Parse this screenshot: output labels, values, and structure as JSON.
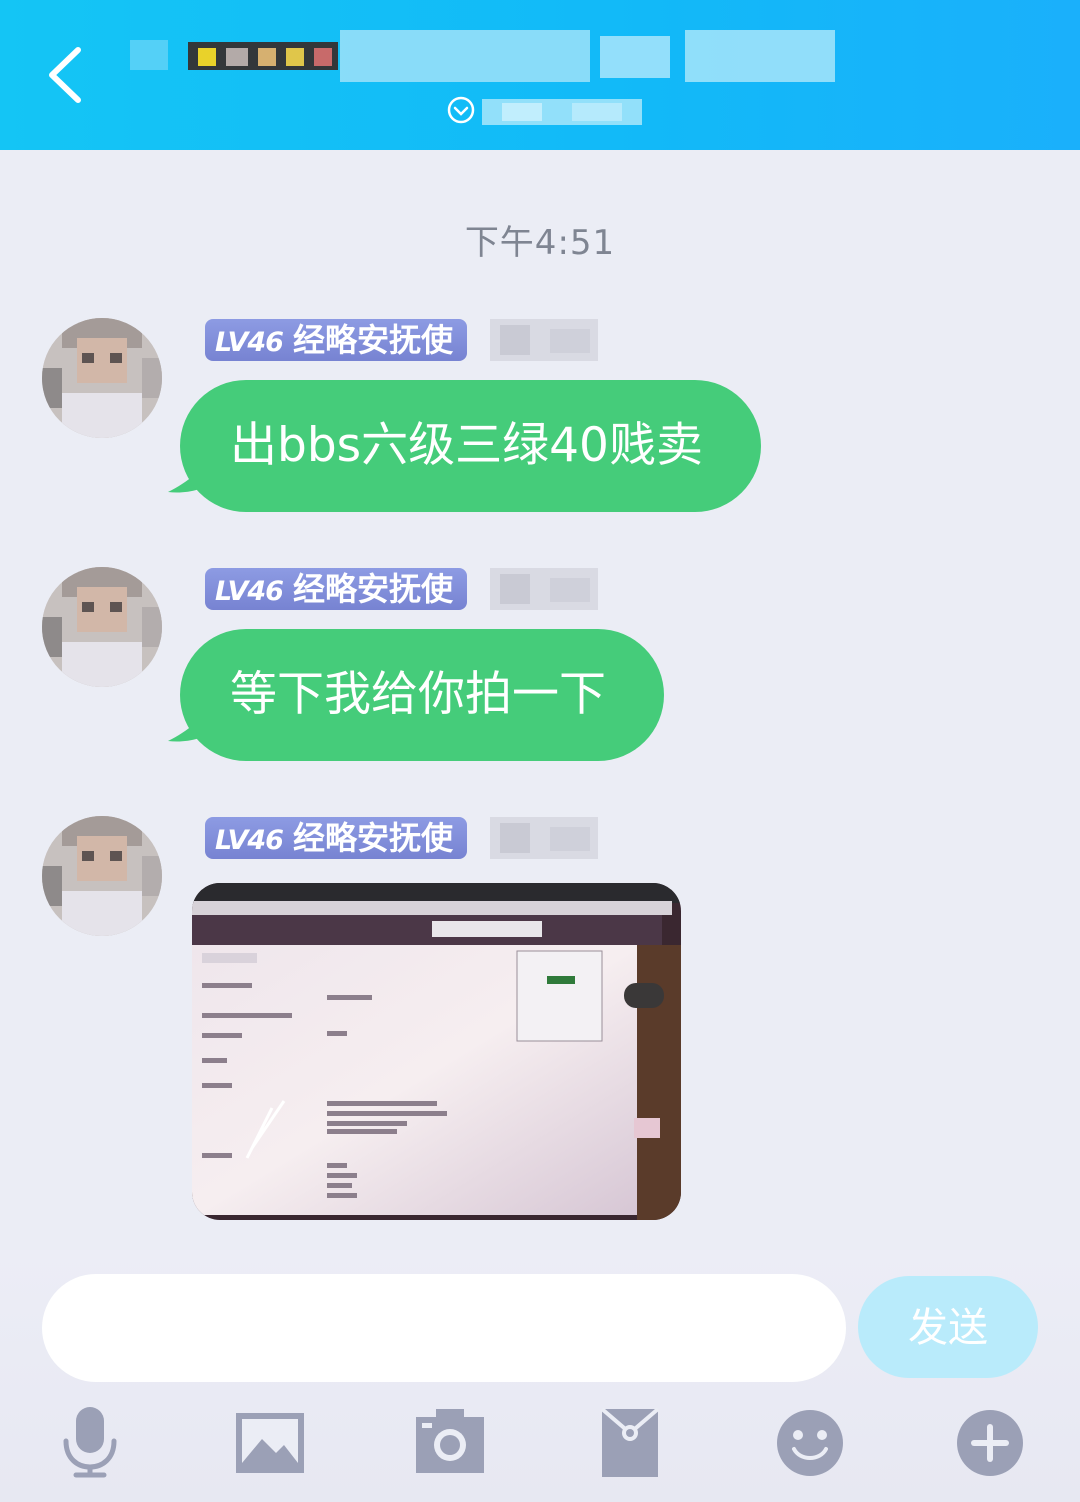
{
  "header": {
    "back_label": "back",
    "subtitle_expand_icon": "chevron-down-circle-icon",
    "title_redacted": true,
    "subtitle_redacted": true
  },
  "chat": {
    "timestamp": "下午4:51",
    "messages": [
      {
        "sender_level": "LV46",
        "sender_title": "经略安抚使",
        "type": "text",
        "text": "出bbs六级三绿40贱卖"
      },
      {
        "sender_level": "LV46",
        "sender_title": "经略安抚使",
        "type": "text",
        "text": "等下我给你拍一下"
      },
      {
        "sender_level": "LV46",
        "sender_title": "经略安抚使",
        "type": "image"
      }
    ]
  },
  "composer": {
    "input_value": "",
    "send_label": "发送",
    "tools": [
      "microphone-icon",
      "image-icon",
      "camera-icon",
      "red-packet-icon",
      "emoji-icon",
      "plus-icon"
    ]
  },
  "colors": {
    "header_blue": "#14c5f5",
    "bubble_green": "#45cc7a",
    "badge_purple": "#7f8ddb",
    "background": "#ebedf5",
    "send_button": "#b9ebfb",
    "tool_icon": "#9ba0b6"
  }
}
